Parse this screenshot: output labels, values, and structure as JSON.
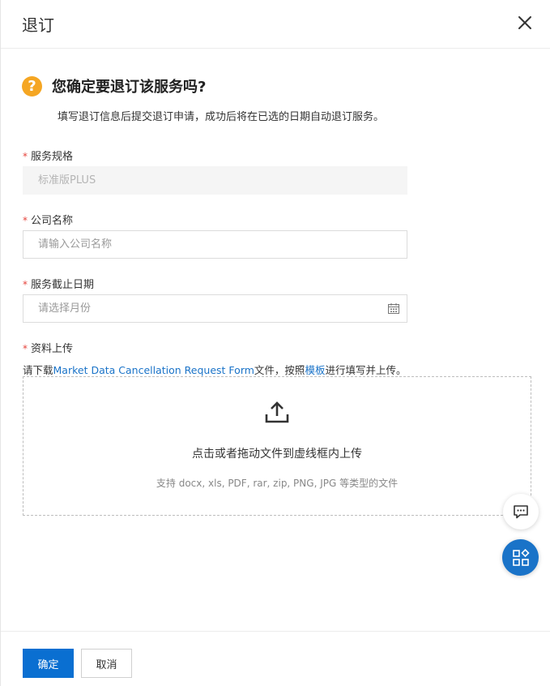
{
  "header": {
    "title": "退订"
  },
  "confirm": {
    "title": "您确定要退订该服务吗?",
    "description": "填写退订信息后提交退订申请，成功后将在已选的日期自动退订服务。"
  },
  "form": {
    "required_mark": "*",
    "spec": {
      "label": "服务规格",
      "value": "标准版PLUS"
    },
    "company": {
      "label": "公司名称",
      "placeholder": "请输入公司名称"
    },
    "end_date": {
      "label": "服务截止日期",
      "placeholder": "请选择月份"
    },
    "upload": {
      "label": "资料上传",
      "hint_prefix": "请下载",
      "hint_link": "Market Data Cancellation Request Form",
      "hint_middle": "文件，按照",
      "hint_template": "模板",
      "hint_suffix": "进行填写并上传。",
      "drop_text": "点击或者拖动文件到虚线框内上传",
      "supported_types": "支持 docx, xls, PDF, rar, zip, PNG, JPG 等类型的文件"
    }
  },
  "footer": {
    "ok_label": "确定",
    "cancel_label": "取消"
  },
  "icons": {
    "close": "close-icon",
    "question": "question-icon",
    "calendar": "calendar-icon",
    "upload": "upload-icon",
    "chat": "chat-icon",
    "apps": "apps-icon"
  },
  "colors": {
    "primary": "#0a6fd1",
    "link": "#1a73c8",
    "warning": "#f5a623",
    "required": "#e5433b"
  }
}
